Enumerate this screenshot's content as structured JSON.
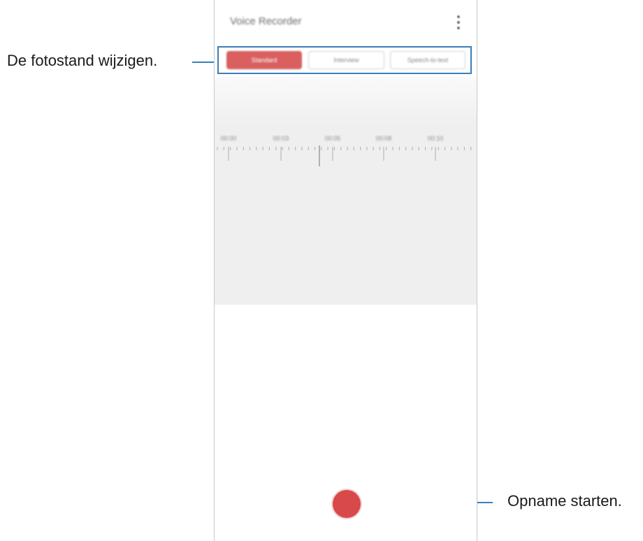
{
  "callouts": {
    "mode_change": "De fotostand wijzigen.",
    "start_recording": "Opname starten."
  },
  "app": {
    "title": "Voice Recorder",
    "more_icon": "more-options-icon"
  },
  "modes": [
    {
      "label": "Standard",
      "active": true
    },
    {
      "label": "Interview",
      "active": false
    },
    {
      "label": "Speech-to-text",
      "active": false
    }
  ],
  "timeline": {
    "labels": [
      "00:00",
      "00:03",
      "00:05",
      "00:08",
      "00:10"
    ]
  },
  "colors": {
    "accent": "#d9605f",
    "record": "#d8494b",
    "callout_line": "#3a7fb8"
  },
  "record_button": {
    "icon": "record-icon"
  }
}
